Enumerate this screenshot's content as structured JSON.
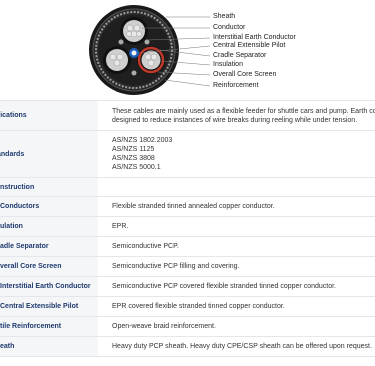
{
  "diagram": {
    "callouts": [
      "Sheath",
      "Conductor",
      "Interstitial Earth Conductor",
      "Central Extensible Pilot",
      "Cradle Separator",
      "Insulation",
      "Overall Core Screen",
      "Reinforcement"
    ]
  },
  "spec_rows": [
    {
      "label": "plications",
      "lines": [
        "These cables are mainly used as a flexible feeder for shuttle cars and pump. Earth co",
        "designed to reduce instances of wire breaks during reeling while under tension."
      ]
    },
    {
      "label": "andards",
      "lines": [
        "AS/NZS 1802.2003",
        "AS/NZS 1125",
        "AS/NZS 3808",
        "AS/NZS 5000.1"
      ]
    },
    {
      "label": "nstruction",
      "lines": [
        ""
      ]
    },
    {
      "label": "Conductors",
      "lines": [
        "Flexible stranded tinned annealed copper conductor."
      ]
    },
    {
      "label": "ulation",
      "lines": [
        "EPR."
      ]
    },
    {
      "label": "adle Separator",
      "lines": [
        "Semiconductive PCP."
      ]
    },
    {
      "label": "verall Core Screen",
      "lines": [
        "Semiconductive PCP filling and covering."
      ]
    },
    {
      "label": "Interstitial Earth Conductor",
      "lines": [
        "Semiconductive PCP covered flexible stranded tinned copper conductor."
      ]
    },
    {
      "label": "Central Extensible Pilot",
      "lines": [
        "EPR covered flexible stranded tinned copper conductor."
      ]
    },
    {
      "label": "tile Reinforcement",
      "lines": [
        "Open-weave braid reinforcement."
      ]
    },
    {
      "label": "eath",
      "lines": [
        "Heavy duty PCP sheath. Heavy duty CPE/CSP sheath can be offered upon request."
      ]
    }
  ]
}
